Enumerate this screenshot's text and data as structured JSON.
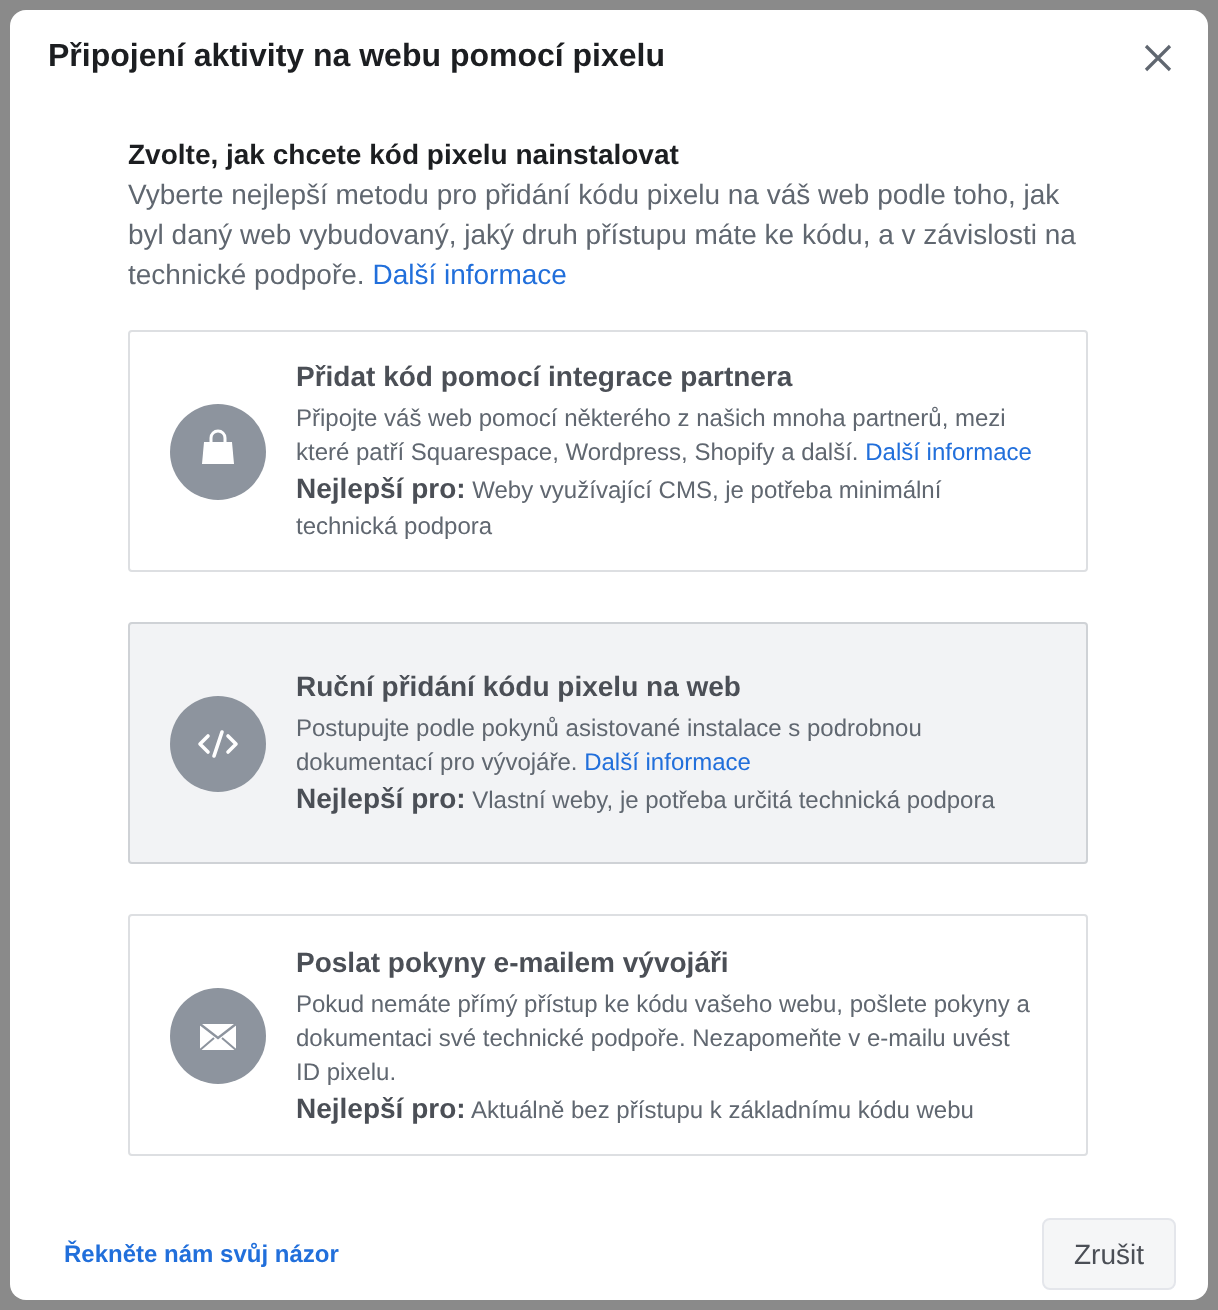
{
  "dialog": {
    "title": "Připojení aktivity na webu pomocí pixelu"
  },
  "intro": {
    "heading": "Zvolte, jak chcete kód pixelu nainstalovat",
    "text": "Vyberte nejlepší metodu pro přidání kódu pixelu na váš web podle toho, jak byl daný web vybudovaný, jaký druh přístupu máte ke kódu, a v závislosti na technické podpoře.",
    "link": "Další informace"
  },
  "options": [
    {
      "kind": "bag",
      "selected": false,
      "title": "Přidat kód pomocí integrace partnera",
      "text": "Připojte váš web pomocí některého z našich mnoha partnerů, mezi které patří Squarespace, Wordpress, Shopify a další.",
      "link": "Další informace",
      "best_label": "Nejlepší pro:",
      "best_text": "Weby využívající CMS, je potřeba minimální technická podpora"
    },
    {
      "kind": "code",
      "selected": true,
      "title": "Ruční přidání kódu pixelu na web",
      "text": "Postupujte podle pokynů asistované instalace s podrobnou dokumentací pro vývojáře.",
      "link": "Další informace",
      "best_label": "Nejlepší pro:",
      "best_text": "Vlastní weby, je potřeba určitá technická podpora"
    },
    {
      "kind": "mail",
      "selected": false,
      "title": "Poslat pokyny e-mailem vývojáři",
      "text": "Pokud nemáte přímý přístup ke kódu vašeho webu, pošlete pokyny a dokumentaci své technické podpoře. Nezapomeňte v e-mailu uvést ID pixelu.",
      "best_label": "Nejlepší pro:",
      "best_text": "Aktuálně bez přístupu k základnímu kódu webu"
    }
  ],
  "footer": {
    "feedback_link": "Řekněte nám svůj názor",
    "cancel_button": "Zrušit"
  }
}
